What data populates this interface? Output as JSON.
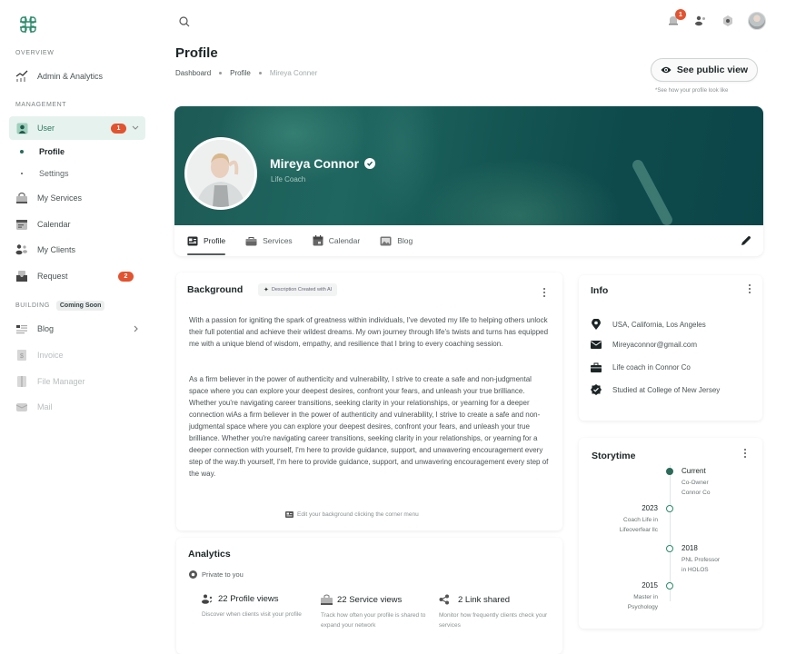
{
  "sidebar": {
    "sections": {
      "overview": "OVERVIEW",
      "management": "MANAGEMENT",
      "building": "BUILDING",
      "building_badge": "Coming Soon"
    },
    "items": {
      "admin_analytics": "Admin & Analytics",
      "user": "User",
      "user_badge": "1",
      "profile": "Profile",
      "settings": "Settings",
      "my_services": "My Services",
      "calendar": "Calendar",
      "my_clients": "My Clients",
      "request": "Request",
      "request_badge": "2",
      "blog": "Blog",
      "invoice": "Invoice",
      "file_manager": "File Manager",
      "mail": "Mail"
    }
  },
  "header": {
    "notification_count": "1",
    "page_title": "Profile",
    "breadcrumb": [
      "Dashboard",
      "Profile",
      "Mireya Conner"
    ],
    "public_view_label": "See public view",
    "public_view_hint": "*See how your profile look like"
  },
  "profile": {
    "name": "Mireya Connor",
    "role": "Life Coach",
    "verified": true,
    "tabs": [
      "Profile",
      "Services",
      "Calendar",
      "Blog"
    ],
    "active_tab": "Profile"
  },
  "background": {
    "title": "Background",
    "ai_chip": "Description Created  with AI",
    "paragraph1": "With a passion for igniting the spark of greatness within individuals, I've devoted my life to helping others unlock their full potential and achieve their wildest dreams. My own journey through life's twists and turns has equipped me with a unique blend of wisdom, empathy, and resilience that I bring to every coaching session.",
    "paragraph2": "As a firm believer in the power of authenticity and vulnerability, I strive to create a safe and non-judgmental space where you can explore your deepest desires, confront your fears, and unleash your true brilliance. Whether you're navigating career transitions, seeking clarity in your relationships, or yearning for a deeper connection wiAs a firm believer in the power of authenticity and vulnerability, I strive to create a safe and non-judgmental space where you can explore your deepest desires, confront your fears, and unleash your true brilliance. Whether you're navigating career transitions, seeking clarity in your relationships, or yearning for a deeper connection with yourself, I'm here to provide guidance, support, and unwavering encouragement every step of the way.th yourself, I'm here to provide guidance, support, and unwavering encouragement every step of the way.",
    "edit_hint": "Edit your background clicking the corner menu"
  },
  "info": {
    "title": "Info",
    "location": "USA, California, Los Angeles",
    "email": "Mireyaconnor@gmail.com",
    "work": "Life coach in Connor Co",
    "education": "Studied at College of New Jersey"
  },
  "storytime": {
    "title": "Storytime",
    "events": [
      {
        "year": "Current",
        "line1": "Co-Owner",
        "line2": "Connor Co"
      },
      {
        "year": "2023",
        "line1": "Coach Life in",
        "line2": "Lifeoverfear llc"
      },
      {
        "year": "2018",
        "line1": "PNL  Professor",
        "line2": "in HOLOS"
      },
      {
        "year": "2015",
        "line1": "Master in",
        "line2": "Psychology"
      }
    ]
  },
  "analytics": {
    "title": "Analytics",
    "privacy": "Private to you",
    "stats": [
      {
        "label": "22 Profile views",
        "desc": "Discover when clients visit your profile"
      },
      {
        "label": "22 Service views",
        "desc": "Track how often your profile is shared to expand your network"
      },
      {
        "label": "2 Link shared",
        "desc": "Monitor how frequently clients check your services"
      }
    ]
  },
  "colors": {
    "accent": "#2b7a5f",
    "badge": "#e2532f",
    "cover": "#145552"
  }
}
